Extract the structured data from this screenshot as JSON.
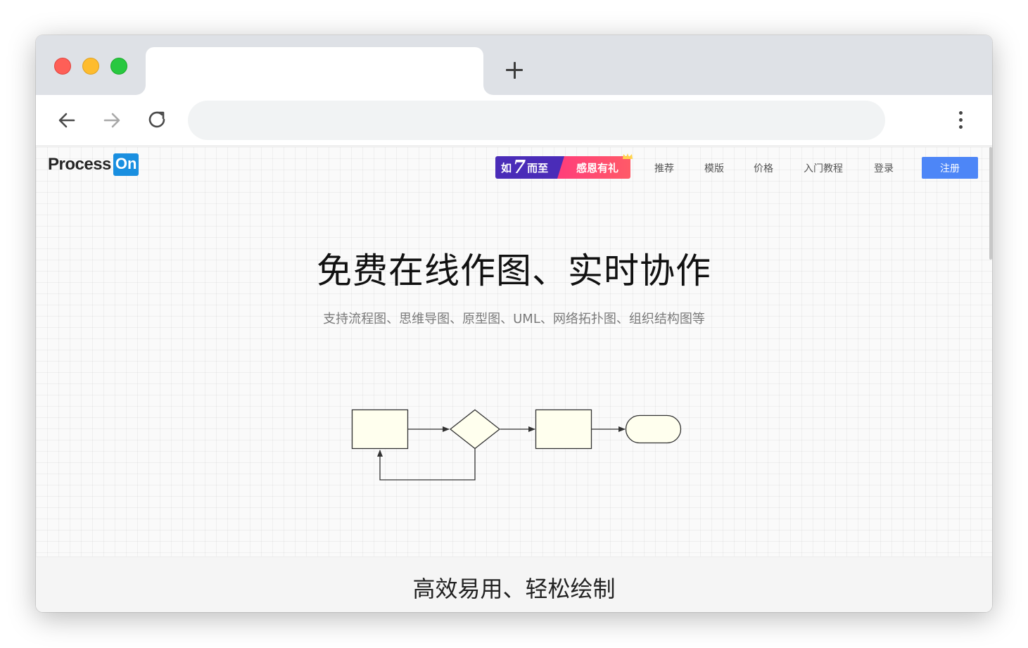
{
  "browser": {
    "new_tab_label": "+",
    "icons": [
      "back-arrow-icon",
      "forward-arrow-icon",
      "reload-icon",
      "kebab-menu-icon"
    ]
  },
  "site": {
    "logo_text": "Process",
    "logo_badge": "On",
    "promo": {
      "prefix": "如",
      "number": "7",
      "suffix": "而至",
      "right_text": "感恩有礼"
    },
    "nav": [
      "推荐",
      "模版",
      "价格",
      "入门教程",
      "登录"
    ],
    "signup_label": "注册",
    "colors": {
      "accent": "#4d86f7",
      "logo_blue": "#1a8fe0",
      "promo_purple": "#4a2cb8",
      "promo_pink": "#ff3d7a",
      "shape_fill": "#ffffee"
    }
  },
  "hero": {
    "title": "免费在线作图、实时协作",
    "subtitle": "支持流程图、思维导图、原型图、UML、网络拓扑图、组织结构图等"
  },
  "features": {
    "title": "高效易用、轻松绘制"
  }
}
